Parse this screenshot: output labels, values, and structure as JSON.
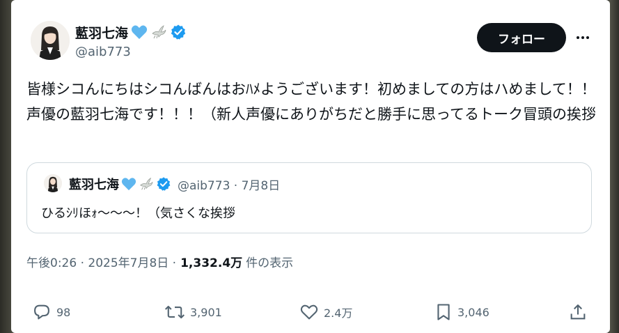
{
  "tweet": {
    "author": {
      "display_name": "藍羽七海",
      "handle": "@aib773",
      "verified": true,
      "name_emoji": [
        "blue-heart",
        "dove"
      ]
    },
    "follow_label": "フォロー",
    "text": "皆様シコんにちはシコんばんはおﾊﾒようございます！初めましての方はハめまして！！声優の藍羽七海です！！！（新人声優にありがちだと勝手に思ってるトーク冒頭の挨拶",
    "quote": {
      "display_name": "藍羽七海",
      "handle_date": "@aib773 · 7月8日",
      "text": "ひるｼﾘほｫ〜〜〜！（気さくな挨拶"
    },
    "timestamp": "午後0:26 · 2025年7月8日 ·",
    "views": "1,332.4万",
    "views_label": "件の表示",
    "actions": {
      "replies": "98",
      "reposts": "3,901",
      "likes": "2.4万",
      "bookmarks": "3,046"
    }
  },
  "colors": {
    "text": "#0f1419",
    "secondary": "#536471",
    "verified": "#1d9bf0",
    "heart": "#5eb6ef",
    "border": "#cfd9de",
    "follow_bg": "#0f1419"
  }
}
